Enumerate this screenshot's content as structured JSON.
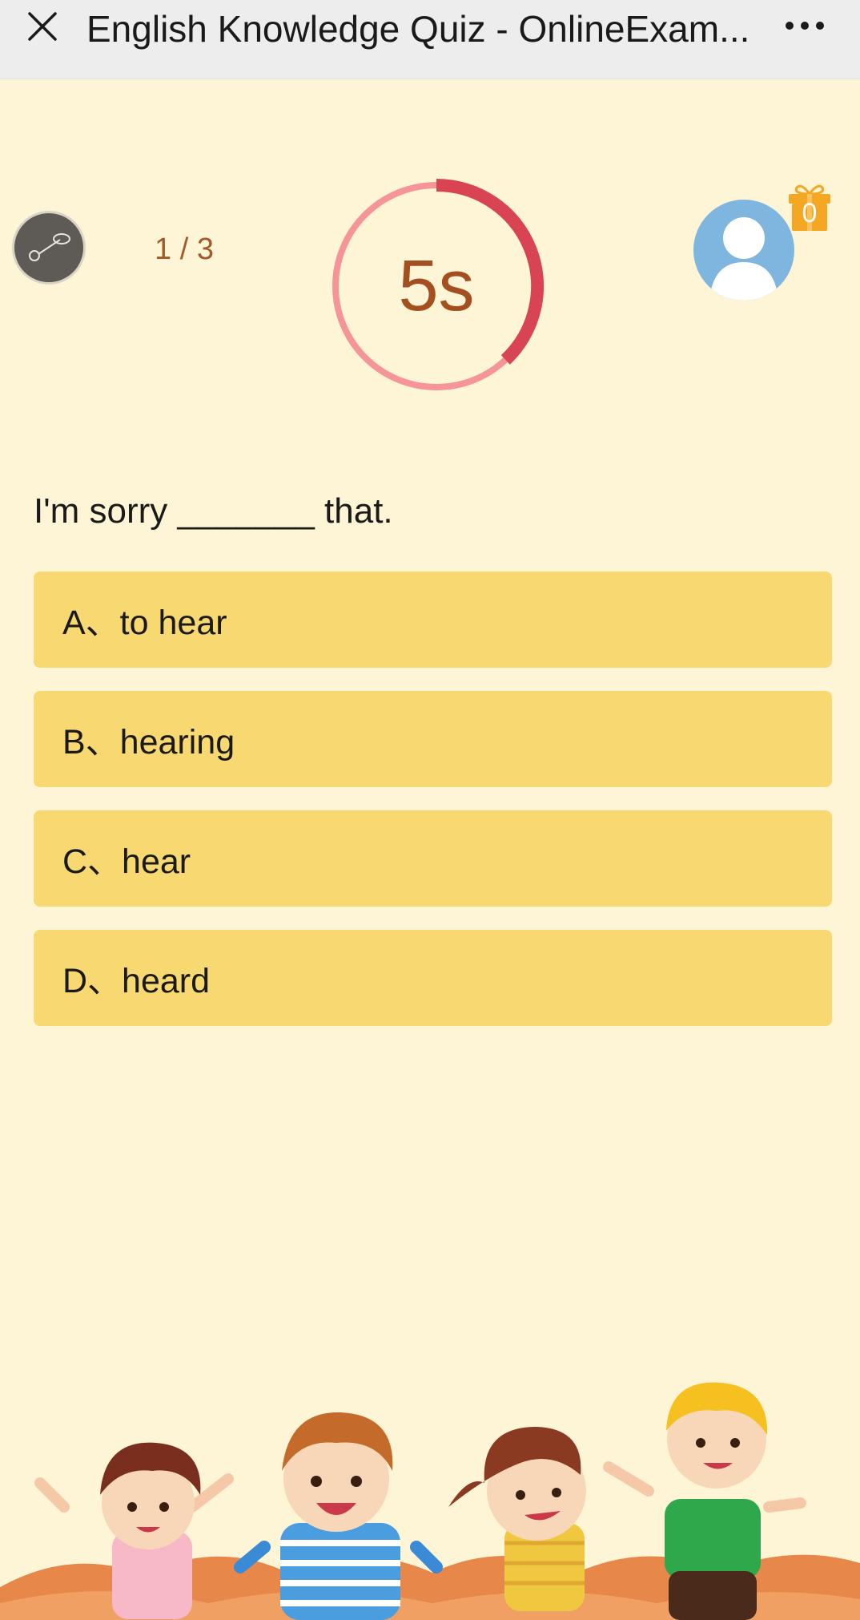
{
  "header": {
    "title": "English Knowledge Quiz - OnlineExam...",
    "close_icon": "close-icon",
    "more_icon": "more-dots-icon"
  },
  "stats": {
    "music_icon": "music-note-icon",
    "progress": "1 / 3",
    "timer": "5s",
    "timer_elapsed_fraction": 0.38,
    "gift_count": "0"
  },
  "question": {
    "text": "I'm sorry _______ that.",
    "options": [
      {
        "label": "A、to hear"
      },
      {
        "label": "B、hearing"
      },
      {
        "label": "C、hear"
      },
      {
        "label": "D、heard"
      }
    ]
  },
  "colors": {
    "background": "#fdf5d6",
    "option": "#f8d870",
    "timer_progress": "#d94452",
    "timer_track": "#f5959a",
    "timer_text": "#a34f1f",
    "gift": "#f5a623"
  }
}
